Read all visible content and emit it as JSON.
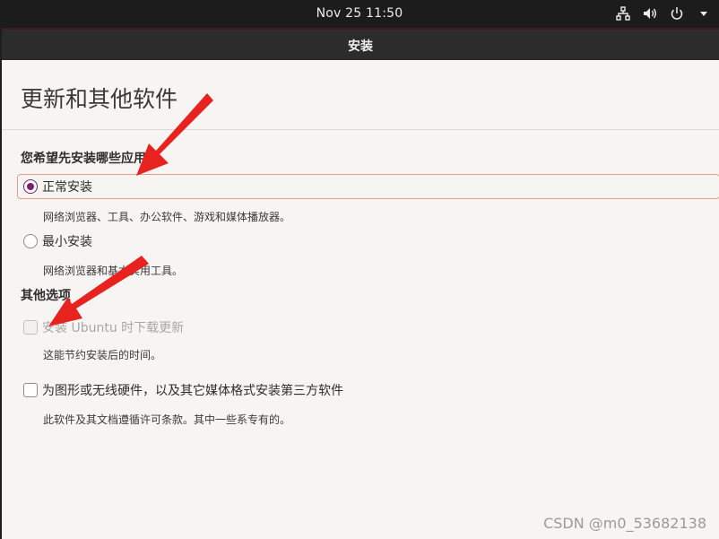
{
  "top_panel": {
    "clock": "Nov 25  11:50",
    "tray_icons": [
      "network-icon",
      "volume-icon",
      "power-icon",
      "chevron-down-icon"
    ]
  },
  "window": {
    "title": "安装"
  },
  "page": {
    "title": "更新和其他软件",
    "install_section": {
      "heading": "您希望先安装哪些应用？",
      "options": [
        {
          "label": "正常安装",
          "checked": true,
          "description": "网络浏览器、工具、办公软件、游戏和媒体播放器。"
        },
        {
          "label": "最小安装",
          "checked": false,
          "description": "网络浏览器和基本实用工具。"
        }
      ]
    },
    "other_section": {
      "heading": "其他选项",
      "options": [
        {
          "label": "安装 Ubuntu 时下载更新",
          "checked": false,
          "disabled": true,
          "description": "这能节约安装后的时间。"
        },
        {
          "label": "为图形或无线硬件，以及其它媒体格式安装第三方软件",
          "checked": false,
          "disabled": false,
          "description": "此软件及其文档遵循许可条款。其中一些系专有的。"
        }
      ]
    }
  },
  "watermark": "CSDN @m0_53682138",
  "colors": {
    "accent": "#77216f",
    "focus_border": "#e9a07d",
    "arrow": "#e8231f"
  }
}
